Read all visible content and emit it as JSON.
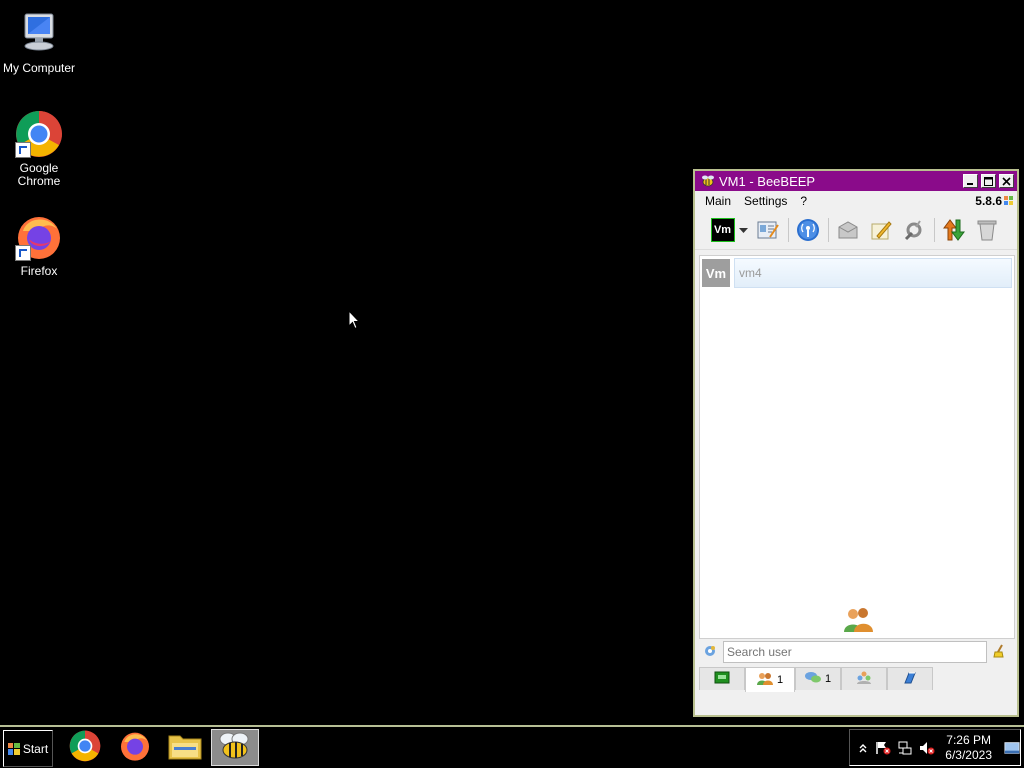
{
  "desktop": {
    "icons": [
      {
        "label_line1": "My Computer",
        "label_line2": ""
      },
      {
        "label_line1": "Google",
        "label_line2": "Chrome"
      },
      {
        "label_line1": "Firefox",
        "label_line2": ""
      }
    ]
  },
  "window": {
    "title": "VM1 - BeeBEEP",
    "accent": "#8a0b8a",
    "menu": [
      "Main",
      "Settings",
      "?"
    ],
    "version": "5.8.6",
    "toolbar_status_label": "Vm",
    "user": {
      "avatar_text": "Vm",
      "name": "vm4"
    },
    "search": {
      "placeholder": "Search user"
    },
    "tabs": [
      {
        "icon": "users-icon",
        "count": "1"
      },
      {
        "icon": "chats-icon",
        "count": "1"
      },
      {
        "icon": "groups-icon",
        "count": ""
      },
      {
        "icon": "shares-icon",
        "count": ""
      }
    ]
  },
  "taskbar": {
    "start_label": "Start",
    "clock_time": "7:26 PM",
    "clock_date": "6/3/2023"
  }
}
